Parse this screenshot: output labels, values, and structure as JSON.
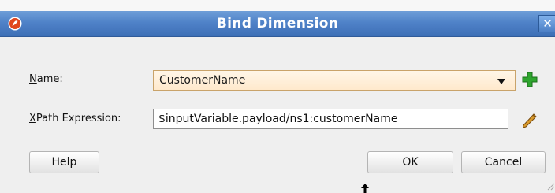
{
  "window": {
    "title": "Bind Dimension",
    "close_glyph": "✕",
    "logo_icon": "oracle-logo-icon"
  },
  "form": {
    "name_label_mnemonic": "N",
    "name_label_rest": "ame:",
    "name_value": "CustomerName",
    "add_icon": "plus-icon",
    "xpath_label_mnemonic": "X",
    "xpath_label_rest": "Path Expression:",
    "xpath_value": "$inputVariable.payload/ns1:customerName",
    "edit_icon": "pencil-icon"
  },
  "buttons": {
    "help": "Help",
    "ok": "OK",
    "cancel": "Cancel"
  },
  "colors": {
    "titlebar": "#4f82c8",
    "combo_bg": "#ffe9cc",
    "plus_icon": "#2fa52f",
    "pencil_icon": "#d99a2b"
  }
}
